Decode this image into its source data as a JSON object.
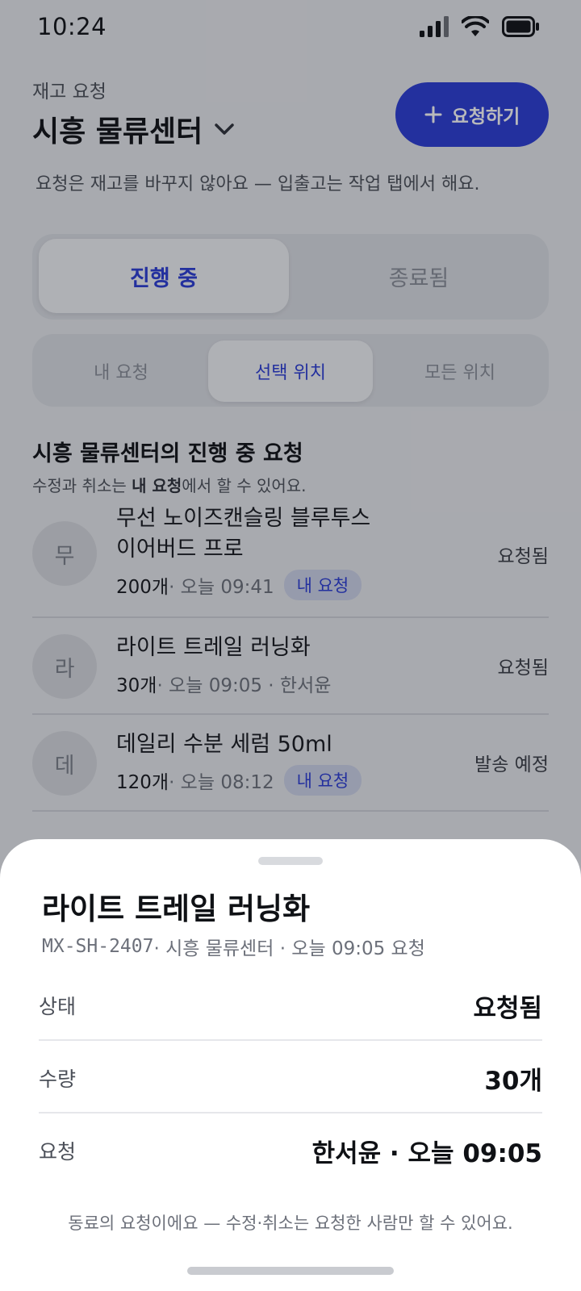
{
  "status_bar": {
    "time": "10:24"
  },
  "header": {
    "eyebrow": "재고 요청",
    "warehouse": "시흥 물류센터",
    "request_button": "요청하기",
    "notice": "요청은 재고를 바꾸지 않아요 — 입출고는 작업 탭에서 해요."
  },
  "status_tabs": {
    "active": "진행 중",
    "inactive": "종료됨"
  },
  "scope_tabs": [
    "내 요청",
    "선택 위치",
    "모든 위치"
  ],
  "section": {
    "title": "시흥 물류센터의 진행 중 요청",
    "sub_bold": "내 요청",
    "sub_prefix": "수정과 취소는 ",
    "sub_suffix": "에서 할 수 있어요."
  },
  "requests": [
    {
      "initial": "무",
      "name_line1": "무선 노이즈캔슬링 블루투스",
      "name_line2": "이어버드 프로",
      "qty": "200개",
      "time": " · 오늘 09:41",
      "badge": "내 요청",
      "state": "요청됨"
    },
    {
      "initial": "라",
      "name_line1": "라이트 트레일 러닝화",
      "qty": "30개",
      "time": " · 오늘 09:05 · 한서윤",
      "state": "요청됨"
    },
    {
      "initial": "데",
      "name_line1": "데일리 수분 세럼 50ml",
      "qty": "120개",
      "time": " · 오늘 08:12",
      "badge": "내 요청",
      "state": "발송 예정"
    }
  ],
  "sheet": {
    "title": "라이트 트레일 러닝화",
    "sku": "MX-SH-2407",
    "sub_rest": " · 시흥 물류센터 · 오늘 09:05 요청",
    "rows": [
      {
        "label": "상태",
        "value": "요청됨"
      },
      {
        "label": "수량",
        "value": "30개"
      },
      {
        "label": "요청",
        "value": "한서윤 · 오늘 09:05"
      }
    ],
    "note": "동료의 요청이에요 — 수정·취소는 요청한 사람만 할 수 있어요."
  },
  "colors": {
    "accent": "#2a3bd6",
    "badge_bg": "#cfd4ea"
  },
  "icons": [
    "signal-icon",
    "wifi-icon",
    "battery-icon",
    "chevron-down-icon",
    "plus-icon"
  ]
}
